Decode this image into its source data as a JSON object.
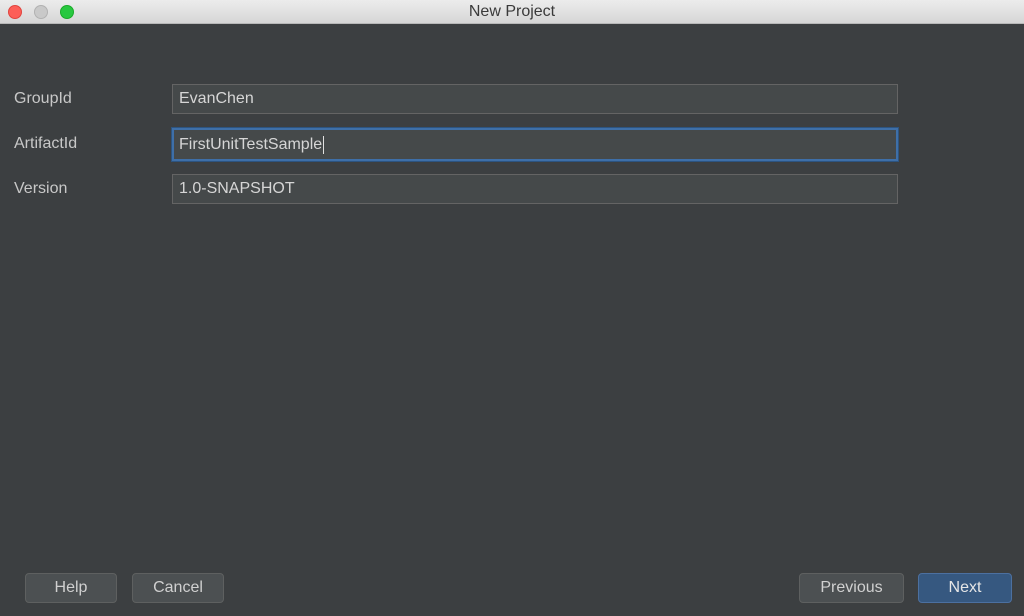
{
  "window": {
    "title": "New Project"
  },
  "form": {
    "group_id": {
      "label": "GroupId",
      "value": "EvanChen"
    },
    "artifact_id": {
      "label": "ArtifactId",
      "value": "FirstUnitTestSample"
    },
    "version": {
      "label": "Version",
      "value": "1.0-SNAPSHOT"
    }
  },
  "buttons": {
    "help": "Help",
    "cancel": "Cancel",
    "previous": "Previous",
    "next": "Next"
  },
  "colors": {
    "background": "#3c3f41",
    "field_background": "#45494a",
    "focus_accent": "#3e6fa8",
    "primary_button": "#365880"
  }
}
